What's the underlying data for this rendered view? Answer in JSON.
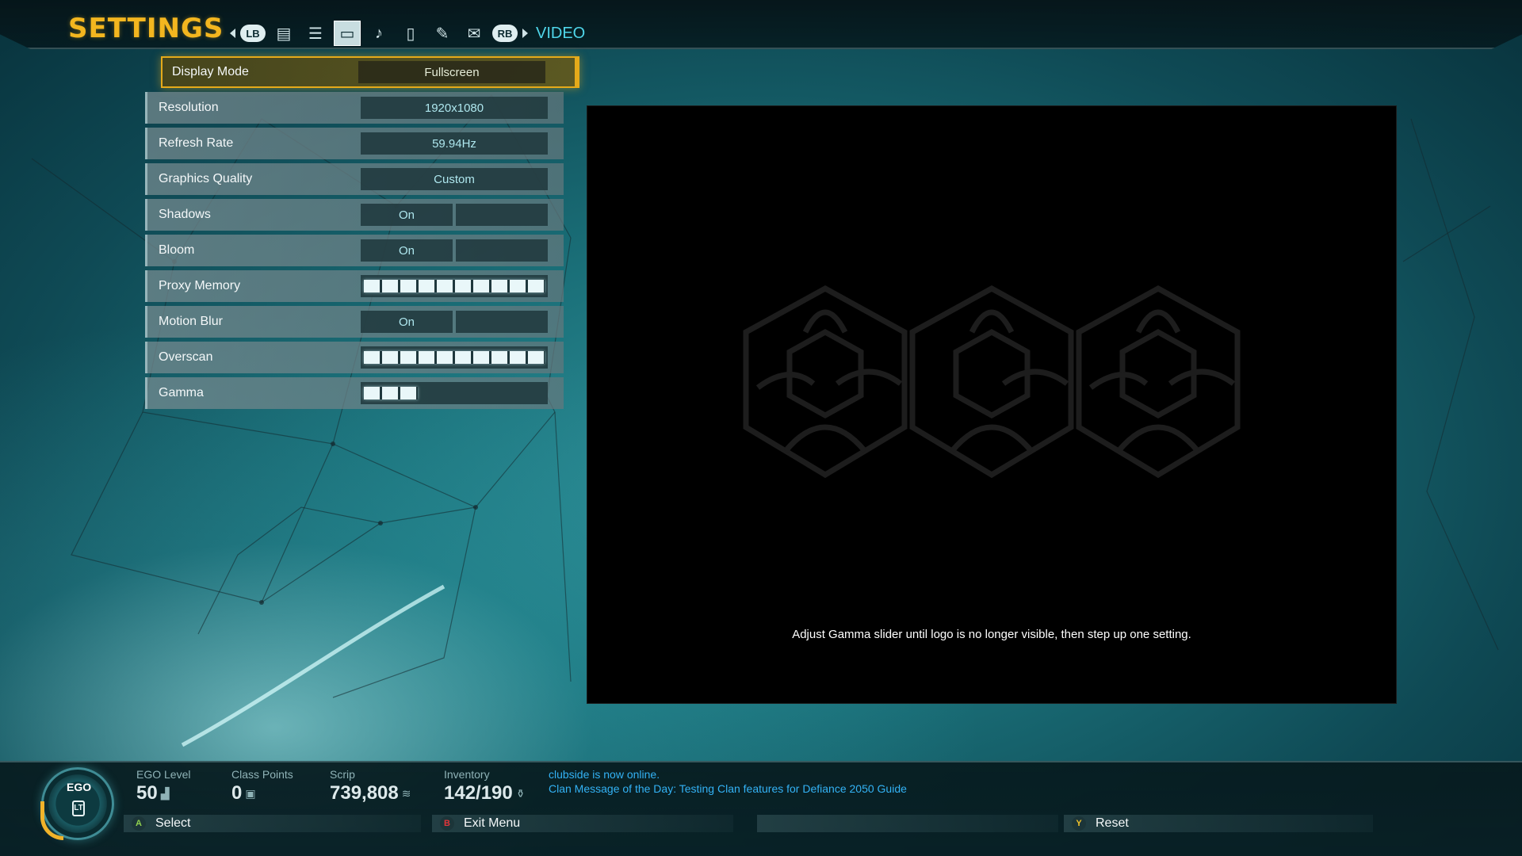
{
  "header": {
    "title": "SETTINGS",
    "lb_label": "LB",
    "rb_label": "RB",
    "section": "VIDEO",
    "tabs": [
      {
        "icon": "profile-icon"
      },
      {
        "icon": "list-icon"
      },
      {
        "icon": "monitor-icon"
      },
      {
        "icon": "audio-icon"
      },
      {
        "icon": "mouse-icon"
      },
      {
        "icon": "controller-icon"
      },
      {
        "icon": "chat-icon"
      }
    ]
  },
  "settings": {
    "display_mode": {
      "label": "Display Mode",
      "value": "Fullscreen"
    },
    "resolution": {
      "label": "Resolution",
      "value": "1920x1080"
    },
    "refresh_rate": {
      "label": "Refresh Rate",
      "value": "59.94Hz"
    },
    "graphics_quality": {
      "label": "Graphics Quality",
      "value": "Custom"
    },
    "shadows": {
      "label": "Shadows",
      "value": "On"
    },
    "bloom": {
      "label": "Bloom",
      "value": "On"
    },
    "proxy_memory": {
      "label": "Proxy Memory",
      "level": 1.0
    },
    "motion_blur": {
      "label": "Motion Blur",
      "value": "On"
    },
    "overscan": {
      "label": "Overscan",
      "level": 1.0
    },
    "gamma": {
      "label": "Gamma",
      "level": 0.3
    }
  },
  "preview": {
    "instruction": "Adjust Gamma slider until logo is no longer visible, then step up one setting."
  },
  "hud": {
    "ego_label": "EGO",
    "ego_badge": "LT",
    "ego_level_label": "EGO Level",
    "ego_level": "50",
    "class_points_label": "Class Points",
    "class_points": "0",
    "scrip_label": "Scrip",
    "scrip": "739,808",
    "inventory_label": "Inventory",
    "inventory": "142/190",
    "message_1": "clubside is now online.",
    "message_2": "Clan Message of the Day: Testing Clan features for Defiance 2050 Guide"
  },
  "actions": {
    "select": {
      "key": "A",
      "label": "Select",
      "color": "#8fd14f"
    },
    "exit": {
      "key": "B",
      "label": "Exit Menu",
      "color": "#e0353a"
    },
    "reset": {
      "key": "Y",
      "label": "Reset",
      "color": "#f0c22a"
    }
  }
}
